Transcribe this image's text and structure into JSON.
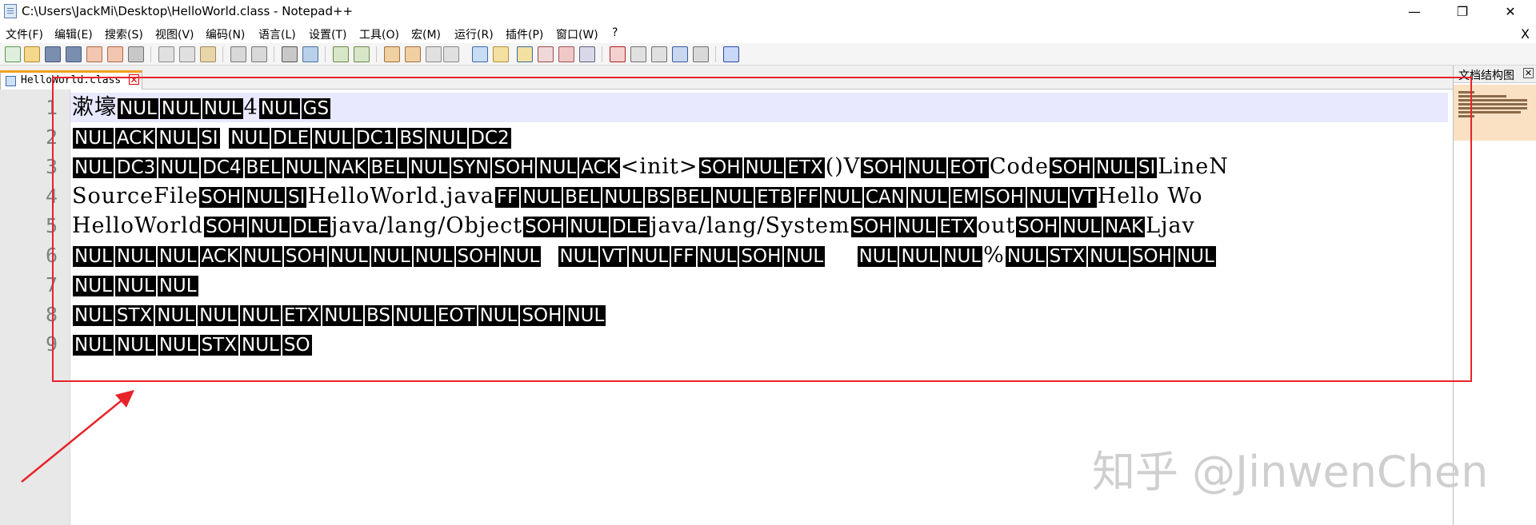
{
  "window": {
    "title": "C:\\Users\\JackMi\\Desktop\\HelloWorld.class - Notepad++",
    "minimize": "—",
    "maximize": "❐",
    "close": "✕"
  },
  "menu": {
    "items": [
      "文件(F)",
      "编辑(E)",
      "搜索(S)",
      "视图(V)",
      "编码(N)",
      "语言(L)",
      "设置(T)",
      "工具(O)",
      "宏(M)",
      "运行(R)",
      "插件(P)",
      "窗口(W)",
      "?"
    ],
    "close": "X"
  },
  "tab": {
    "label": "HelloWorld.class",
    "close": "✕"
  },
  "editor": {
    "line_numbers": [
      "1",
      "2",
      "3",
      "4",
      "5",
      "6",
      "7",
      "8",
      "9"
    ],
    "lines": [
      [
        [
          "t",
          "漱壕"
        ],
        [
          "c",
          "NUL"
        ],
        [
          "c",
          "NUL"
        ],
        [
          "c",
          "NUL"
        ],
        [
          "t",
          "4"
        ],
        [
          "c",
          "NUL"
        ],
        [
          "c",
          "GS"
        ]
      ],
      [
        [
          "c",
          "NUL"
        ],
        [
          "c",
          "ACK"
        ],
        [
          "c",
          "NUL"
        ],
        [
          "c",
          "SI"
        ],
        [
          "t",
          " "
        ],
        [
          "c",
          "NUL"
        ],
        [
          "c",
          "DLE"
        ],
        [
          "c",
          "NUL"
        ],
        [
          "c",
          "DC1"
        ],
        [
          "c",
          "BS"
        ],
        [
          "c",
          "NUL"
        ],
        [
          "c",
          "DC2"
        ]
      ],
      [
        [
          "c",
          "NUL"
        ],
        [
          "c",
          "DC3"
        ],
        [
          "c",
          "NUL"
        ],
        [
          "c",
          "DC4"
        ],
        [
          "c",
          "BEL"
        ],
        [
          "c",
          "NUL"
        ],
        [
          "c",
          "NAK"
        ],
        [
          "c",
          "BEL"
        ],
        [
          "c",
          "NUL"
        ],
        [
          "c",
          "SYN"
        ],
        [
          "c",
          "SOH"
        ],
        [
          "c",
          "NUL"
        ],
        [
          "c",
          "ACK"
        ],
        [
          "t",
          "<init>"
        ],
        [
          "c",
          "SOH"
        ],
        [
          "c",
          "NUL"
        ],
        [
          "c",
          "ETX"
        ],
        [
          "t",
          "()V"
        ],
        [
          "c",
          "SOH"
        ],
        [
          "c",
          "NUL"
        ],
        [
          "c",
          "EOT"
        ],
        [
          "t",
          "Code"
        ],
        [
          "c",
          "SOH"
        ],
        [
          "c",
          "NUL"
        ],
        [
          "c",
          "SI"
        ],
        [
          "t",
          "LineN"
        ]
      ],
      [
        [
          "t",
          "SourceFile"
        ],
        [
          "c",
          "SOH"
        ],
        [
          "c",
          "NUL"
        ],
        [
          "c",
          "SI"
        ],
        [
          "t",
          "HelloWorld.java"
        ],
        [
          "c",
          "FF"
        ],
        [
          "c",
          "NUL"
        ],
        [
          "c",
          "BEL"
        ],
        [
          "c",
          "NUL"
        ],
        [
          "c",
          "BS"
        ],
        [
          "c",
          "BEL"
        ],
        [
          "c",
          "NUL"
        ],
        [
          "c",
          "ETB"
        ],
        [
          "c",
          "FF"
        ],
        [
          "c",
          "NUL"
        ],
        [
          "c",
          "CAN"
        ],
        [
          "c",
          "NUL"
        ],
        [
          "c",
          "EM"
        ],
        [
          "c",
          "SOH"
        ],
        [
          "c",
          "NUL"
        ],
        [
          "c",
          "VT"
        ],
        [
          "t",
          "Hello Wo"
        ]
      ],
      [
        [
          "t",
          "HelloWorld"
        ],
        [
          "c",
          "SOH"
        ],
        [
          "c",
          "NUL"
        ],
        [
          "c",
          "DLE"
        ],
        [
          "t",
          "java/lang/Object"
        ],
        [
          "c",
          "SOH"
        ],
        [
          "c",
          "NUL"
        ],
        [
          "c",
          "DLE"
        ],
        [
          "t",
          "java/lang/System"
        ],
        [
          "c",
          "SOH"
        ],
        [
          "c",
          "NUL"
        ],
        [
          "c",
          "ETX"
        ],
        [
          "t",
          "out"
        ],
        [
          "c",
          "SOH"
        ],
        [
          "c",
          "NUL"
        ],
        [
          "c",
          "NAK"
        ],
        [
          "t",
          "Ljav"
        ]
      ],
      [
        [
          "c",
          "NUL"
        ],
        [
          "c",
          "NUL"
        ],
        [
          "c",
          "NUL"
        ],
        [
          "c",
          "ACK"
        ],
        [
          "c",
          "NUL"
        ],
        [
          "c",
          "SOH"
        ],
        [
          "c",
          "NUL"
        ],
        [
          "c",
          "NUL"
        ],
        [
          "c",
          "NUL"
        ],
        [
          "c",
          "SOH"
        ],
        [
          "c",
          "NUL"
        ],
        [
          "t",
          "  "
        ],
        [
          "c",
          "NUL"
        ],
        [
          "c",
          "VT"
        ],
        [
          "c",
          "NUL"
        ],
        [
          "c",
          "FF"
        ],
        [
          "c",
          "NUL"
        ],
        [
          "c",
          "SOH"
        ],
        [
          "c",
          "NUL"
        ],
        [
          "t",
          "    "
        ],
        [
          "c",
          "NUL"
        ],
        [
          "c",
          "NUL"
        ],
        [
          "c",
          "NUL"
        ],
        [
          "t",
          "%"
        ],
        [
          "c",
          "NUL"
        ],
        [
          "c",
          "STX"
        ],
        [
          "c",
          "NUL"
        ],
        [
          "c",
          "SOH"
        ],
        [
          "c",
          "NUL"
        ]
      ],
      [
        [
          "c",
          "NUL"
        ],
        [
          "c",
          "NUL"
        ],
        [
          "c",
          "NUL"
        ]
      ],
      [
        [
          "c",
          "NUL"
        ],
        [
          "c",
          "STX"
        ],
        [
          "c",
          "NUL"
        ],
        [
          "c",
          "NUL"
        ],
        [
          "c",
          "NUL"
        ],
        [
          "c",
          "ETX"
        ],
        [
          "c",
          "NUL"
        ],
        [
          "c",
          "BS"
        ],
        [
          "c",
          "NUL"
        ],
        [
          "c",
          "EOT"
        ],
        [
          "c",
          "NUL"
        ],
        [
          "c",
          "SOH"
        ],
        [
          "c",
          "NUL"
        ]
      ],
      [
        [
          "c",
          "NUL"
        ],
        [
          "c",
          "NUL"
        ],
        [
          "c",
          "NUL"
        ],
        [
          "c",
          "STX"
        ],
        [
          "c",
          "NUL"
        ],
        [
          "c",
          "SO"
        ]
      ]
    ]
  },
  "side_panel": {
    "title": "文档结构图",
    "close": "✕"
  },
  "watermark": "知乎 @JinwenChen",
  "colors": {
    "current_line": "#e8e8ff",
    "control_char_bg": "#000000",
    "annotation_red": "#e8232a",
    "tab_accent": "#f2a020"
  }
}
